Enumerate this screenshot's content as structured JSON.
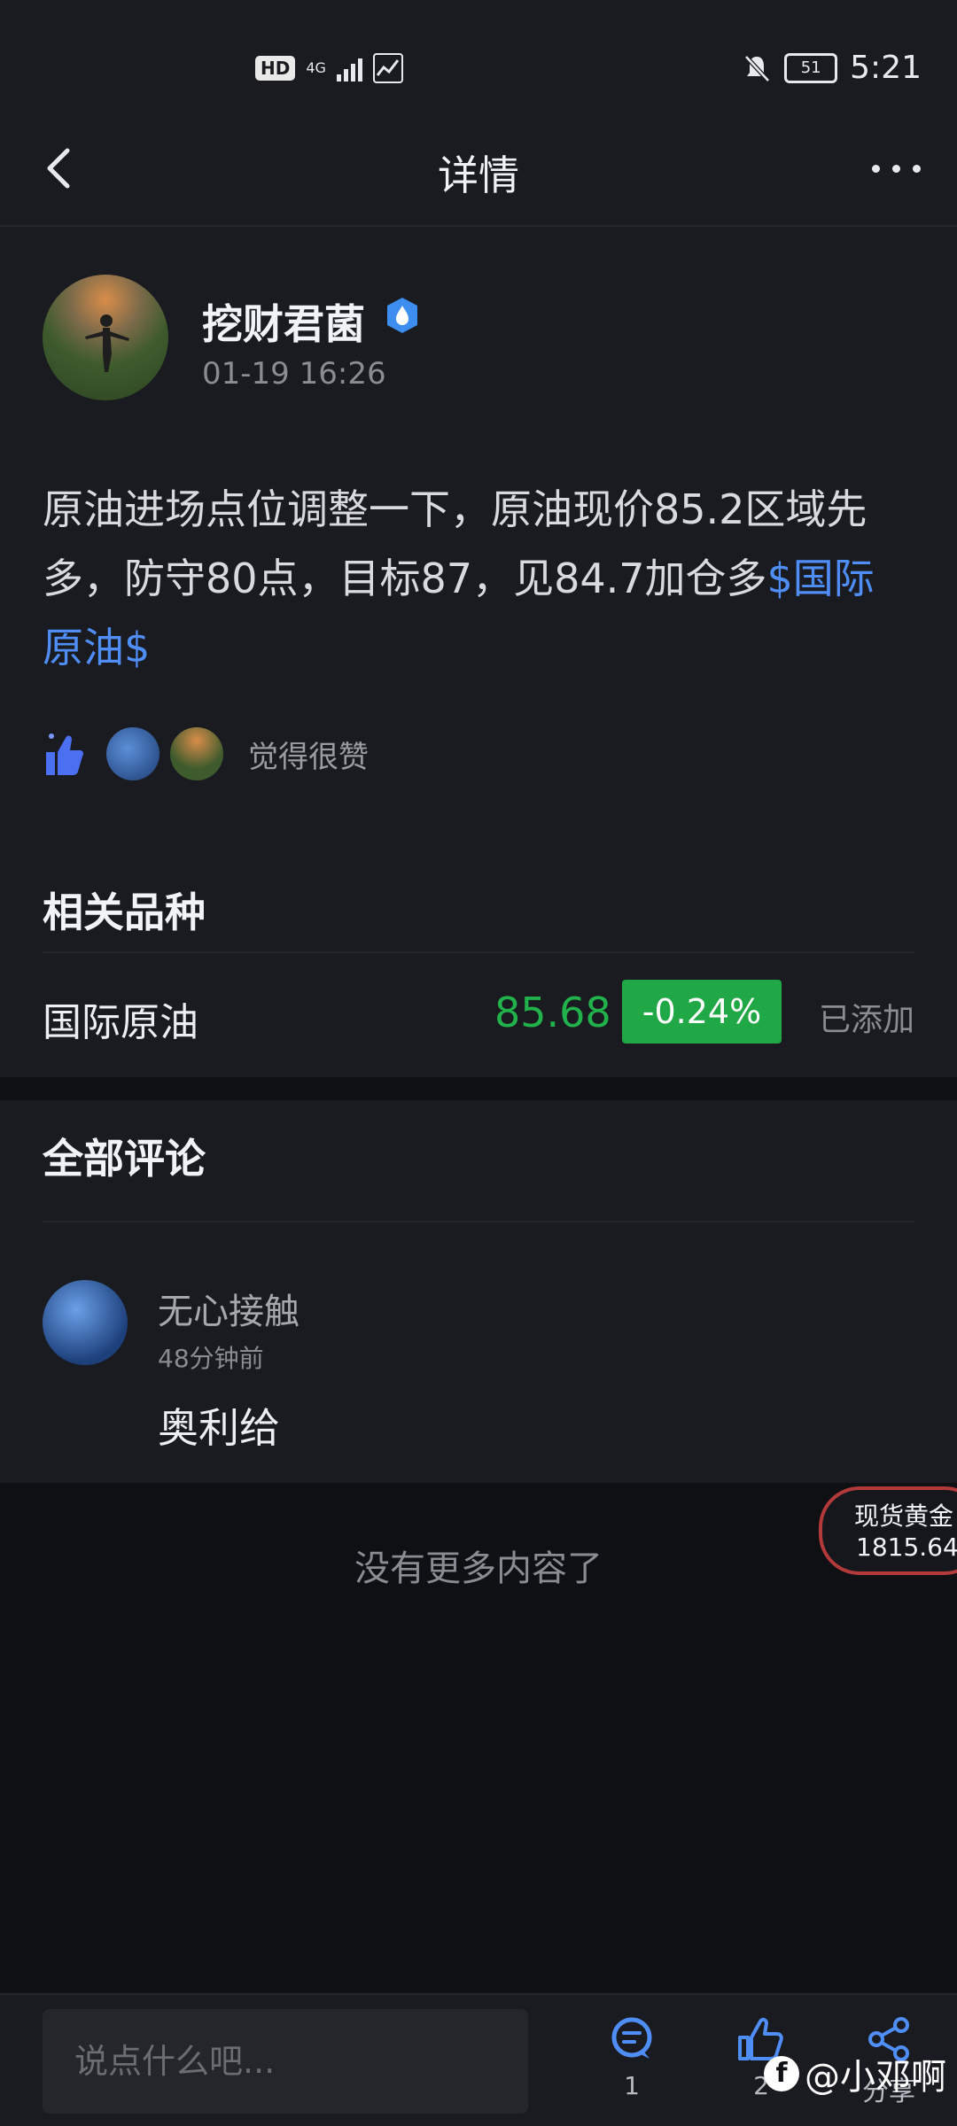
{
  "status_bar": {
    "hd_badge": "HD",
    "network": "4G",
    "battery": "51",
    "time": "5:21"
  },
  "header": {
    "title": "详情"
  },
  "post": {
    "author": "挖财君菌",
    "time": "01-19 16:26",
    "body": "原油进场点位调整一下，原油现价85.2区域先多，防守80点，目标87，见84.7加仓多",
    "tag": "$国际原油$",
    "like_text": "觉得很赞"
  },
  "related": {
    "title": "相关品种",
    "name": "国际原油",
    "price": "85.68",
    "change": "-0.24%",
    "status": "已添加"
  },
  "comments": {
    "title": "全部评论",
    "items": [
      {
        "name": "无心接触",
        "time": "48分钟前",
        "text": "奥利给"
      }
    ],
    "no_more": "没有更多内容了"
  },
  "floating_widget": {
    "name": "现货黄金",
    "price": "1815.64"
  },
  "bottom_bar": {
    "input_placeholder": "说点什么吧...",
    "comment_count": "1",
    "like_count": "2",
    "share_label": "分享"
  },
  "watermark": "@小邓啊",
  "colors": {
    "accent": "#4f8ef7",
    "price_up": "#22b24c",
    "change_bg": "#1fa845",
    "background": "#0f1014",
    "card": "#1a1b20"
  }
}
